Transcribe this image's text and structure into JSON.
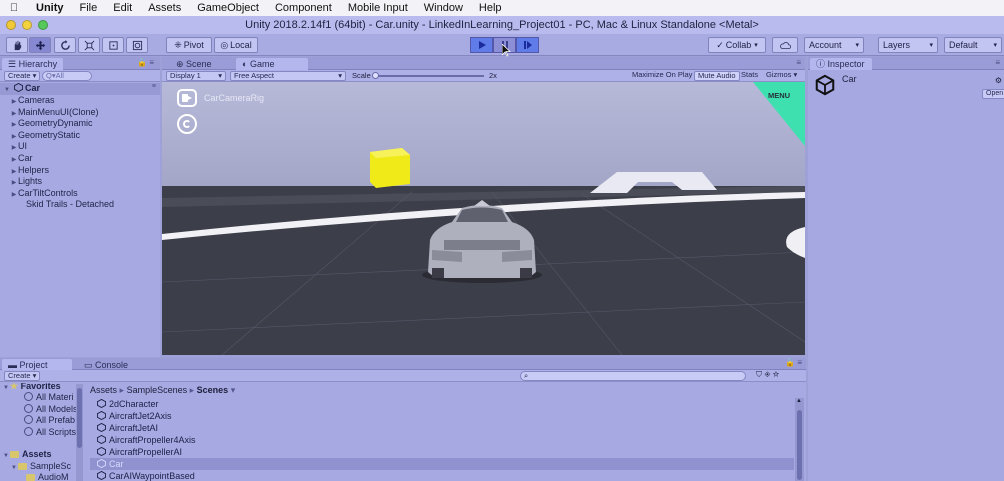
{
  "menubar": {
    "app": "Unity",
    "items": [
      "File",
      "Edit",
      "Assets",
      "GameObject",
      "Component",
      "Mobile Input",
      "Window",
      "Help"
    ]
  },
  "window": {
    "title": "Unity 2018.2.14f1 (64bit) - Car.unity - LinkedInLearning_Project01 - PC, Mac & Linux Standalone <Metal>"
  },
  "toolbar": {
    "pivot": "Pivot",
    "local": "Local",
    "collab": "Collab",
    "account": "Account",
    "layers": "Layers",
    "layout": "Default"
  },
  "hierarchy": {
    "tab": "Hierarchy",
    "create": "Create",
    "search_placeholder": "Q▾All",
    "root": "Car",
    "items": [
      "Cameras",
      "MainMenuUI(Clone)",
      "GeometryDynamic",
      "GeometryStatic",
      "UI",
      "Car",
      "Helpers",
      "Lights",
      "CarTiltControls",
      "Skid Trails - Detached"
    ]
  },
  "scene_tabs": {
    "scene": "Scene",
    "game": "Game"
  },
  "game_bar": {
    "display": "Display 1",
    "aspect": "Free Aspect",
    "scale_label": "Scale",
    "scale_value": "2x",
    "maximize": "Maximize On Play",
    "mute": "Mute Audio",
    "stats": "Stats",
    "gizmos": "Gizmos"
  },
  "game_view": {
    "camera_label": "CarCameraRig",
    "menu_label": "MENU",
    "menu_color": "#3fe0b0"
  },
  "inspector": {
    "tab": "Inspector",
    "object_name": "Car",
    "open_btn": "Open"
  },
  "project": {
    "tab": "Project",
    "console_tab": "Console",
    "create": "Create",
    "favorites_label": "Favorites",
    "favorites": [
      "All Materi",
      "All Models",
      "All Prefab",
      "All Scripts"
    ],
    "assets_label": "Assets",
    "assets_children": [
      "SampleSc",
      "AudioM"
    ],
    "breadcrumb": [
      "Assets",
      "SampleScenes",
      "Scenes"
    ],
    "files": [
      "2dCharacter",
      "AircraftJet2Axis",
      "AircraftJetAI",
      "AircraftPropeller4Axis",
      "AircraftPropellerAI",
      "Car",
      "CarAIWaypointBased"
    ],
    "selected_index": 5
  }
}
